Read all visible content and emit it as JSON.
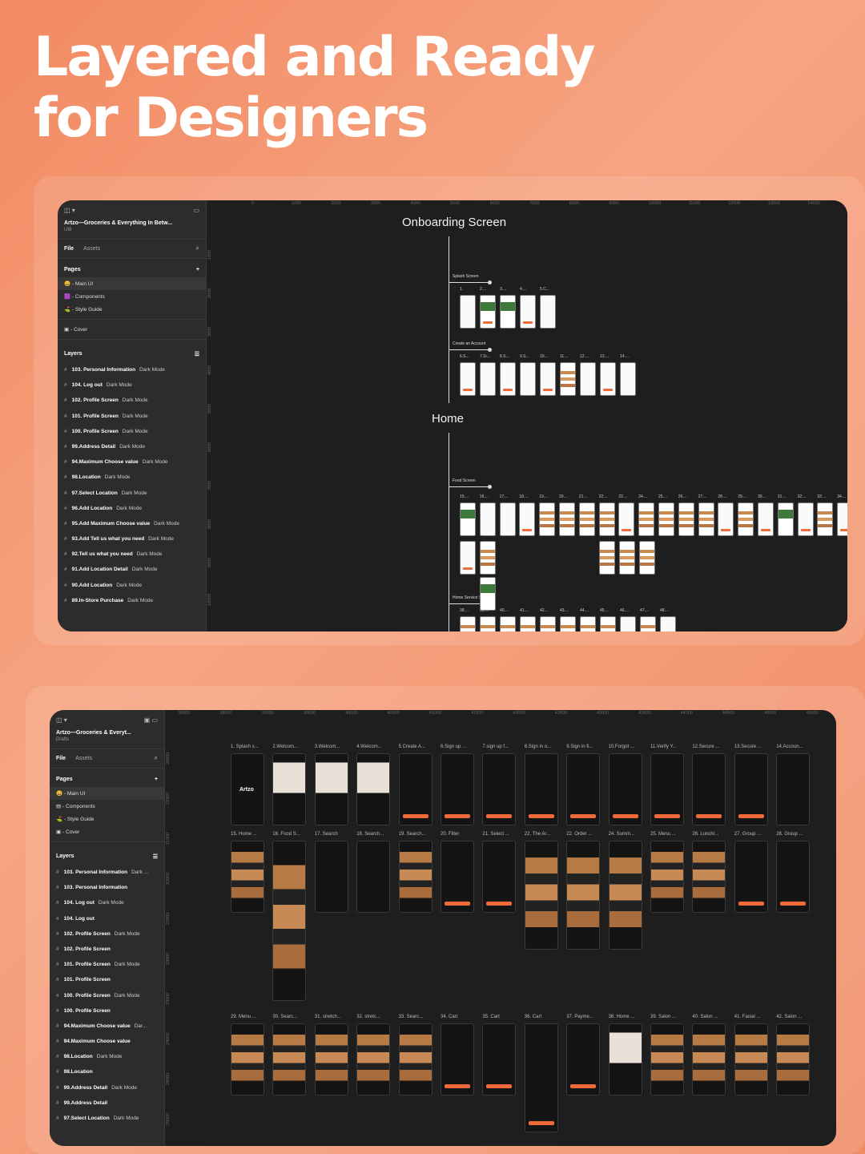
{
  "headline": {
    "line1": "Layered and Ready",
    "line2": "for Designers"
  },
  "colors": {
    "background": "#f28a62",
    "accent": "#f06a3a",
    "canvas": "#1e1e1e",
    "sidebar": "#2c2c2c"
  },
  "win1": {
    "file_title": "Artzo—Groceries & Everything In Betw...",
    "file_sub": "UI8",
    "tabs": {
      "file": "File",
      "assets": "Assets"
    },
    "pages_label": "Pages",
    "pages": [
      "- Main UI",
      "- Components",
      "- Style Guide",
      "- Cover"
    ],
    "layers_label": "Layers",
    "layers": [
      {
        "name": "103. Personal Information",
        "mode": "Dark Mode"
      },
      {
        "name": "104. Log out",
        "mode": "Dark Mode"
      },
      {
        "name": "102. Profile Screen",
        "mode": "Dark Mode"
      },
      {
        "name": "101. Profile Screen",
        "mode": "Dark Mode"
      },
      {
        "name": "100. Profile Screen",
        "mode": "Dark Mode"
      },
      {
        "name": "99.Address Detail",
        "mode": "Dark Mode"
      },
      {
        "name": "94.Maximum Choose value",
        "mode": "Dark Mode"
      },
      {
        "name": "98.Location",
        "mode": "Dark Mode"
      },
      {
        "name": "97.Select Location",
        "mode": "Dark Mode"
      },
      {
        "name": "96.Add Location",
        "mode": "Dark Mode"
      },
      {
        "name": "95.Add Maximum Choose value",
        "mode": "Dark Mode"
      },
      {
        "name": "93.Add Tell us what you need",
        "mode": "Dark Mode"
      },
      {
        "name": "92.Tell us what you need",
        "mode": "Dark Mode"
      },
      {
        "name": "91.Add Location Detail",
        "mode": "Dark Mode"
      },
      {
        "name": "90.Add Location",
        "mode": "Dark Mode"
      },
      {
        "name": "89.In-Store Purchase",
        "mode": "Dark Mode"
      }
    ],
    "ruler_x": [
      "0",
      "1000",
      "2000",
      "3000",
      "4000",
      "5000",
      "6000",
      "7000",
      "8000",
      "9000",
      "10000",
      "11000",
      "12000",
      "13000",
      "14000"
    ],
    "ruler_y": [
      "1000",
      "2000",
      "3000",
      "4000",
      "5000",
      "6000",
      "7000",
      "8000",
      "9000",
      "10000"
    ],
    "section_onboarding": "Onboarding Screen",
    "section_home": "Home",
    "group_splash": "Splash Screen",
    "group_create": "Create an Account",
    "group_food": "Food Screen",
    "group_home_service": "Home Service Screen",
    "splash_labels": [
      "1.",
      "2....",
      "3....",
      "4....",
      "5.C..."
    ],
    "create_labels": [
      "6.S...",
      "7.Si...",
      "8.S...",
      "9.S...",
      "10....",
      "11....",
      "12....",
      "13....",
      "14...."
    ],
    "food_labels": [
      "15....",
      "16....",
      "17....",
      "18....",
      "19....",
      "20....",
      "21....",
      "22....",
      "22....",
      "24....",
      "25....",
      "26....",
      "27....",
      "28....",
      "29....",
      "30....",
      "31....",
      "32....",
      "33....",
      "34....",
      "35....",
      "36....",
      "37...."
    ],
    "home_service_labels": [
      "38....",
      "39....",
      "40....",
      "41....",
      "42....",
      "43....",
      "44....",
      "45....",
      "46....",
      "47....",
      "48...."
    ]
  },
  "win2": {
    "file_title": "Artzo—Groceries & Everyt...",
    "file_sub": "Drafts",
    "tabs": {
      "file": "File",
      "assets": "Assets"
    },
    "pages_label": "Pages",
    "pages": [
      "- Main UI",
      "- Components",
      "- Style Guide",
      "- Cover"
    ],
    "layers_label": "Layers",
    "layers": [
      {
        "name": "103. Personal Information",
        "mode": "Dark ..."
      },
      {
        "name": "103. Personal Information",
        "mode": ""
      },
      {
        "name": "104. Log out",
        "mode": "Dark Mode"
      },
      {
        "name": "104. Log out",
        "mode": ""
      },
      {
        "name": "102. Profile Screen",
        "mode": "Dark Mode"
      },
      {
        "name": "102. Profile Screen",
        "mode": ""
      },
      {
        "name": "101. Profile Screen",
        "mode": "Dark Mode"
      },
      {
        "name": "101. Profile Screen",
        "mode": ""
      },
      {
        "name": "100. Profile Screen",
        "mode": "Dark Mode"
      },
      {
        "name": "100. Profile Screen",
        "mode": ""
      },
      {
        "name": "94.Maximum Choose value",
        "mode": "Dar..."
      },
      {
        "name": "94.Maximum Choose value",
        "mode": ""
      },
      {
        "name": "98.Location",
        "mode": "Dark Mode"
      },
      {
        "name": "98.Location",
        "mode": ""
      },
      {
        "name": "99.Address Detail",
        "mode": "Dark Mode"
      },
      {
        "name": "99.Address Detail",
        "mode": ""
      },
      {
        "name": "97.Select Location",
        "mode": "Dark Mode"
      }
    ],
    "ruler_x": [
      "38000",
      "38500",
      "39000",
      "39500",
      "40000",
      "40500",
      "41000",
      "41500",
      "42000",
      "42500",
      "43000",
      "43500",
      "44000",
      "44500",
      "45000",
      "45500"
    ],
    "ruler_y": [
      "20500",
      "21000",
      "21500",
      "22000",
      "22500",
      "23000",
      "23500",
      "24000",
      "24500",
      "25000"
    ],
    "row1": [
      "1. Splash s...",
      "2.Welcom...",
      "3.Welcom...",
      "4.Welcom...",
      "5.Create A...",
      "6.Sign up ...",
      "7.sign up f...",
      "8.Sign in o...",
      "9.Sign in fi...",
      "10.Forgot ...",
      "11.Verify Y...",
      "12.Secure ...",
      "13.Secure ...",
      "14.Accoun..."
    ],
    "row2": [
      "15. Home ...",
      "16. Food S...",
      "17. Search",
      "18. Search...",
      "19. Search...",
      "20. Filter",
      "21. Select ...",
      "22. The Ar...",
      "22. Order ...",
      "24. Summ...",
      "25. Menu ...",
      "26. Lunch/...",
      "27. Group ...",
      "28. Group ..."
    ],
    "row3": [
      "29. Menu ...",
      "30. Searc...",
      "31. stretch...",
      "32. stretc...",
      "33. Searc...",
      "34. Cart",
      "35. Cart",
      "36. Cart",
      "37. Payme...",
      "38. Home ...",
      "39. Salon ...",
      "40. Salon ...",
      "41. Facial ...",
      "42. Salon ..."
    ],
    "splash_brand": "Artzo"
  }
}
